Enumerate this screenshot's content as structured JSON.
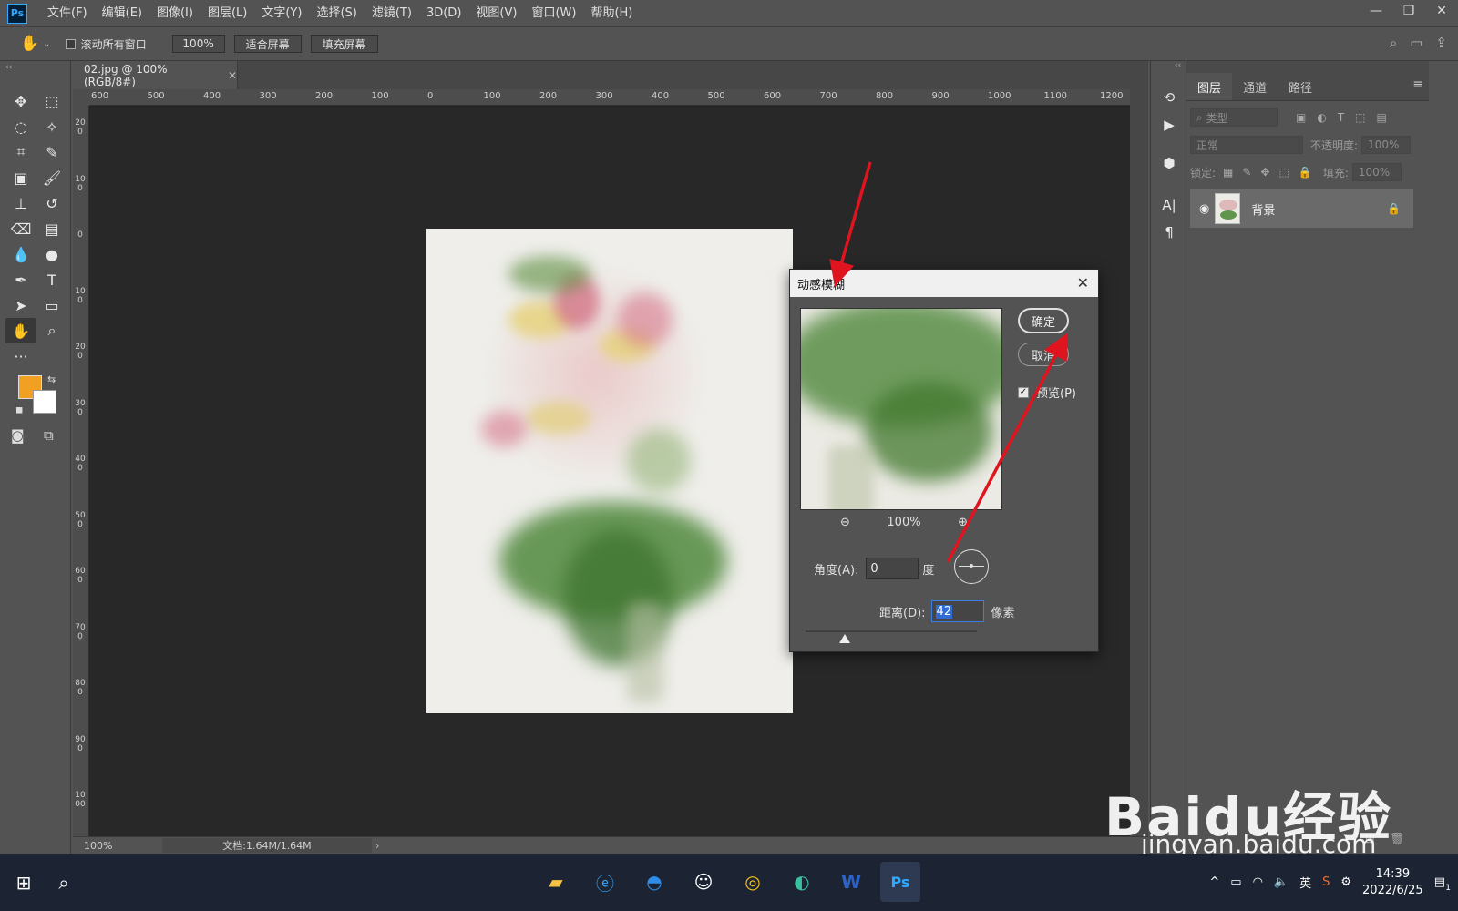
{
  "app": {
    "logo": "Ps"
  },
  "menu": [
    "文件(F)",
    "编辑(E)",
    "图像(I)",
    "图层(L)",
    "文字(Y)",
    "选择(S)",
    "滤镜(T)",
    "3D(D)",
    "视图(V)",
    "窗口(W)",
    "帮助(H)"
  ],
  "options": {
    "scroll_all_label": "滚动所有窗口",
    "zoom_value": "100%",
    "fit_screen": "适合屏幕",
    "fill_screen": "填充屏幕"
  },
  "document": {
    "tab_title": "02.jpg @ 100%(RGB/8#)",
    "zoom": "100%",
    "doc_size": "文档:1.64M/1.64M"
  },
  "ruler_h": [
    "600",
    "500",
    "400",
    "300",
    "200",
    "100",
    "0",
    "100",
    "200",
    "300",
    "400",
    "500",
    "600",
    "700",
    "800",
    "900",
    "1000",
    "1100",
    "1200"
  ],
  "ruler_v": [
    "200",
    "100",
    "0",
    "100",
    "200",
    "300",
    "400",
    "500",
    "600",
    "700",
    "800",
    "900",
    "1000"
  ],
  "dialog": {
    "title": "动感模糊",
    "ok": "确定",
    "cancel": "取消",
    "preview_label": "预览(P)",
    "preview_checked": true,
    "zoom": "100%",
    "angle_label": "角度(A):",
    "angle_value": "0",
    "angle_unit": "度",
    "distance_label": "距离(D):",
    "distance_value": "42",
    "distance_unit": "像素"
  },
  "layers_panel": {
    "tabs": [
      "图层",
      "通道",
      "路径"
    ],
    "filter_kind": "类型",
    "blend_mode": "正常",
    "opacity_label": "不透明度:",
    "opacity_value": "100%",
    "lock_label": "锁定:",
    "fill_label": "填充:",
    "fill_value": "100%",
    "layer_name": "背景"
  },
  "colors": {
    "foreground": "#f2a024",
    "background": "#ffffff",
    "accent": "#31a8ff"
  },
  "taskbar": {
    "ime": "英",
    "time": "14:39",
    "date": "2022/6/25",
    "notifications": "1"
  },
  "watermark": {
    "line1": "Baidu经验",
    "line2": "jingyan.baidu.com"
  }
}
